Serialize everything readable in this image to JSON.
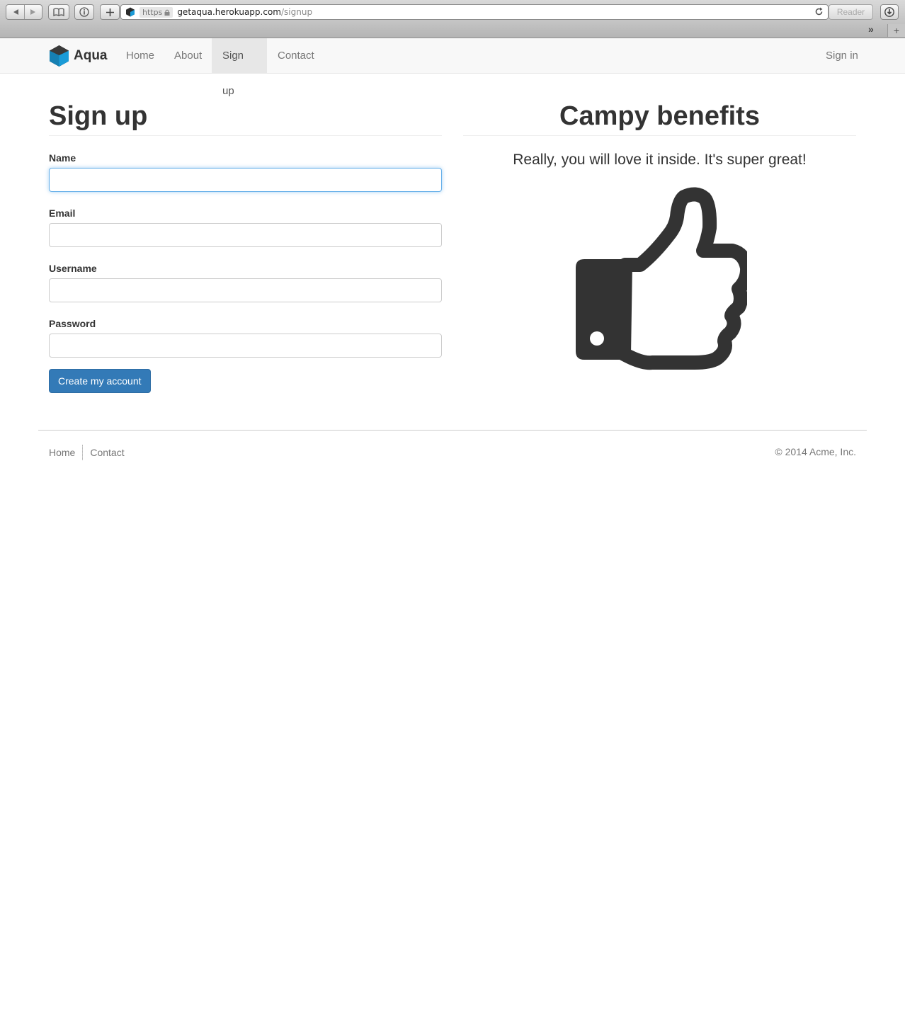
{
  "browser": {
    "url_scheme": "https",
    "url_host": "getaqua.herokuapp.com",
    "url_path": "/signup",
    "reader_label": "Reader"
  },
  "navbar": {
    "brand": "Aqua",
    "items": [
      {
        "label": "Home"
      },
      {
        "label": "About"
      },
      {
        "label": "Sign up",
        "active": true
      },
      {
        "label": "Contact"
      }
    ],
    "sign_in": "Sign in"
  },
  "signup": {
    "title": "Sign up",
    "fields": [
      {
        "label": "Name",
        "value": "",
        "focused": true
      },
      {
        "label": "Email",
        "value": ""
      },
      {
        "label": "Username",
        "value": ""
      },
      {
        "label": "Password",
        "value": ""
      }
    ],
    "submit_label": "Create my account"
  },
  "benefits": {
    "title": "Campy benefits",
    "lead": "Really, you will love it inside. It's super great!",
    "icon": "thumbs-up-icon"
  },
  "footer": {
    "links": [
      {
        "label": "Home"
      },
      {
        "label": "Contact"
      }
    ],
    "copyright": "© 2014 Acme, Inc."
  },
  "colors": {
    "primary": "#337ab7",
    "brand_blue": "#1a9bd7",
    "text": "#333333",
    "muted": "#777777"
  }
}
